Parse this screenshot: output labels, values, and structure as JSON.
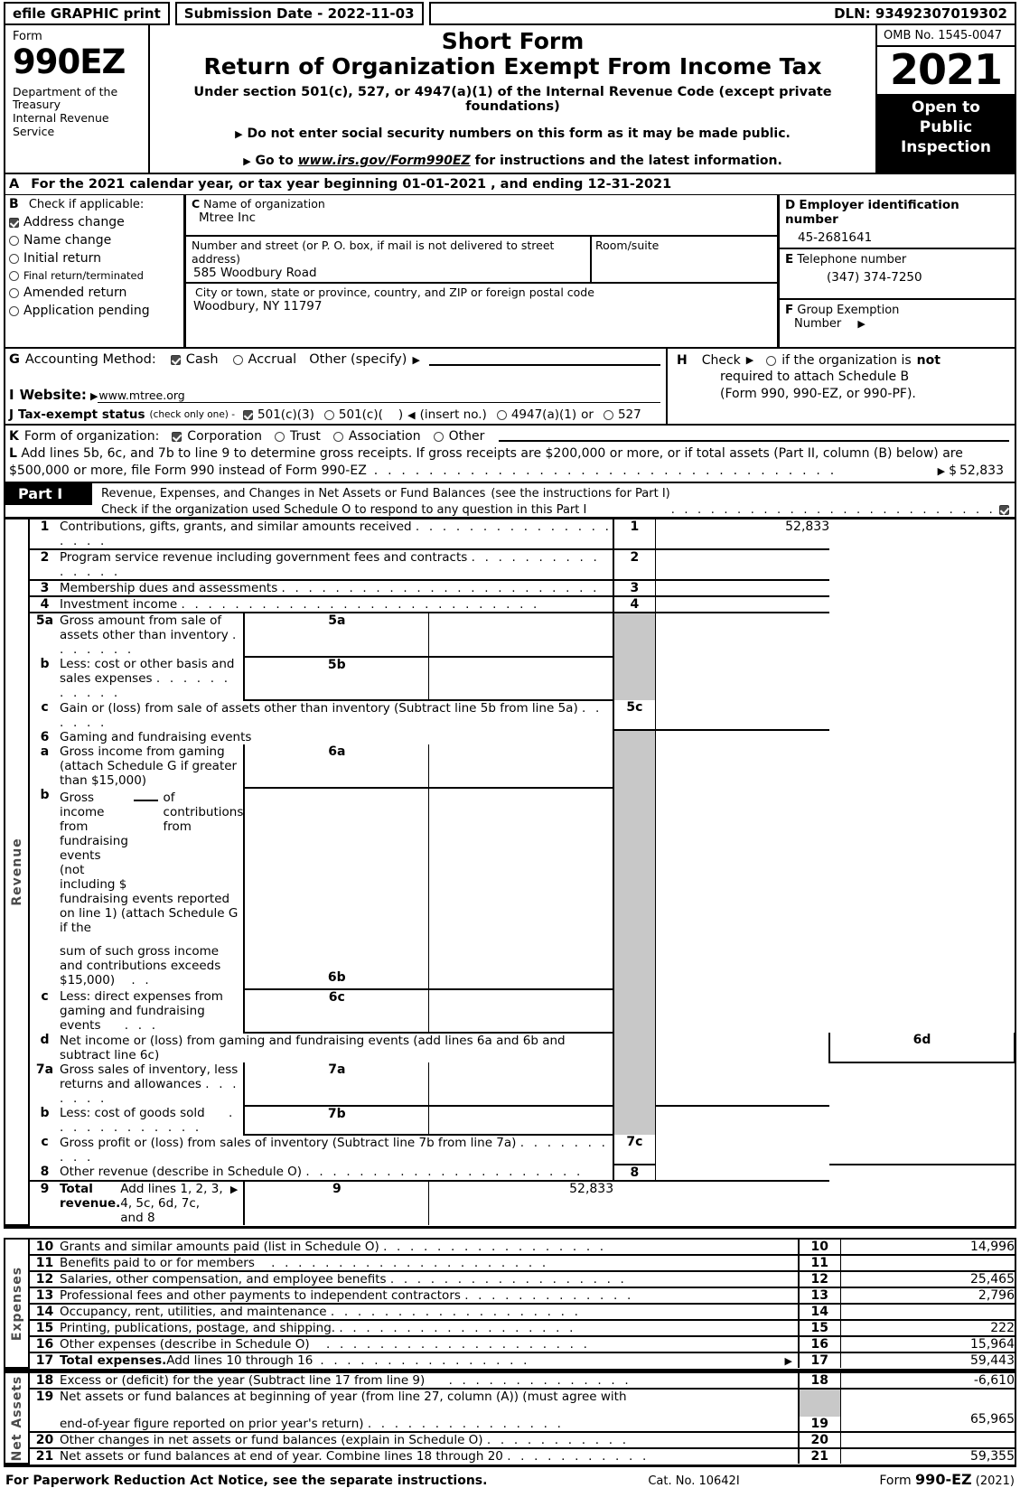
{
  "efile": {
    "graphic_label": "efile GRAPHIC print",
    "submission_label": "Submission Date - 2022-11-03",
    "dln": "DLN: 93492307019302"
  },
  "header": {
    "form_label": "Form",
    "form_number": "990EZ",
    "department": "Department of the Treasury\nInternal Revenue Service",
    "title_short": "Short Form",
    "title_main": "Return of Organization Exempt From Income Tax",
    "subtitle": "Under section 501(c), 527, or 4947(a)(1) of the Internal Revenue Code (except private foundations)",
    "bullet1": "Do not enter social security numbers on this form as it may be made public.",
    "bullet2_pre": "Go to ",
    "bullet2_link": "www.irs.gov/Form990EZ",
    "bullet2_post": " for instructions and the latest information.",
    "omb": "OMB No. 1545-0047",
    "year": "2021",
    "open_to_public": "Open to\nPublic\nInspection"
  },
  "lineA": {
    "letter": "A",
    "text_pre": "For the 2021 calendar year, or tax year beginning ",
    "begin_date": "01-01-2021",
    "text_mid": " , and ending ",
    "end_date": "12-31-2021"
  },
  "sectionB": {
    "letter": "B",
    "title": "Check if applicable:",
    "items": [
      {
        "label": "Address change",
        "checked": true,
        "small": false
      },
      {
        "label": "Name change",
        "checked": false,
        "small": false
      },
      {
        "label": "Initial return",
        "checked": false,
        "small": false
      },
      {
        "label": "Final return/terminated",
        "checked": false,
        "small": true
      },
      {
        "label": "Amended return",
        "checked": false,
        "small": false
      },
      {
        "label": "Application pending",
        "checked": false,
        "small": false
      }
    ]
  },
  "sectionC": {
    "letter": "C",
    "name_caption": "Name of organization",
    "name_value": "Mtree Inc",
    "street_caption": "Number and street (or P. O. box, if mail is not delivered to street address)",
    "street_value": "585 Woodbury Road",
    "room_caption": "Room/suite",
    "room_value": "",
    "city_caption": "City or town, state or province, country, and ZIP or foreign postal code",
    "city_value": "Woodbury, NY   11797"
  },
  "sectionD": {
    "letter": "D",
    "caption": "Employer identification number",
    "value": "45-2681641"
  },
  "sectionE": {
    "letter": "E",
    "caption": "Telephone number",
    "value": "(347) 374-7250"
  },
  "sectionF": {
    "letter": "F",
    "caption_line1": "Group Exemption",
    "caption_line2": "Number",
    "value": ""
  },
  "sectionG": {
    "letter": "G",
    "label": "Accounting Method:",
    "cash": "Cash",
    "cash_checked": true,
    "accrual": "Accrual",
    "accrual_checked": false,
    "other": "Other (specify)",
    "other_value": ""
  },
  "sectionH": {
    "letter": "H",
    "check_label": "Check",
    "text_a": "if the organization is ",
    "text_not": "not",
    "line2": "required to attach Schedule B",
    "line3": "(Form 990, 990-EZ, or 990-PF).",
    "checked": false
  },
  "sectionI": {
    "letter": "I",
    "label": "Website:",
    "value": "www.mtree.org"
  },
  "sectionJ": {
    "letter": "J",
    "label": "Tax-exempt status",
    "note": "(check only one) -",
    "opt1": "501(c)(3)",
    "opt1_checked": true,
    "opt2": "501(c)(",
    "opt2_checked": false,
    "opt2_paren": ")",
    "insert": "(insert no.)",
    "opt3": "4947(a)(1)",
    "opt3_checked": false,
    "or": "or",
    "opt4": "527",
    "opt4_checked": false
  },
  "sectionK": {
    "letter": "K",
    "label": "Form of organization:",
    "options": [
      {
        "label": "Corporation",
        "checked": true
      },
      {
        "label": "Trust",
        "checked": false
      },
      {
        "label": "Association",
        "checked": false
      },
      {
        "label": "Other",
        "checked": false
      }
    ],
    "other_value": ""
  },
  "sectionL": {
    "letter": "L",
    "line1": "Add lines 5b, 6c, and 7b to line 9 to determine gross receipts. If gross receipts are $200,000 or more, or if total assets (Part II, column (B) below) are",
    "line2": "$500,000 or more, file Form 990 instead of Form 990-EZ",
    "amount_prefix": "$",
    "amount": "52,833"
  },
  "partI": {
    "tag": "Part I",
    "title": "Revenue, Expenses, and Changes in Net Assets or Fund Balances",
    "title_note": "(see the instructions for Part I)",
    "schedule_o_text": "Check if the organization used Schedule O to respond to any question in this Part I",
    "schedule_o_checked": true
  },
  "revenue": {
    "vertical_label": "Revenue",
    "rows": [
      {
        "num": "1",
        "desc": "Contributions, gifts, grants, and similar amounts received",
        "dots": 19,
        "code": "1",
        "amount": "52,833",
        "gray": false
      },
      {
        "num": "2",
        "desc": "Program service revenue including government fees and contracts",
        "dots": 15,
        "code": "2",
        "amount": "",
        "gray": false
      },
      {
        "num": "3",
        "desc": "Membership dues and assessments",
        "dots": 24,
        "code": "3",
        "amount": "",
        "gray": false
      },
      {
        "num": "4",
        "desc": "Investment income",
        "dots": 27,
        "code": "4",
        "amount": "",
        "gray": false
      }
    ],
    "line5a": {
      "num": "5a",
      "desc": "Gross amount from sale of assets other than inventory",
      "dots": 7,
      "inner_code": "5a",
      "inner_amount": ""
    },
    "line5b": {
      "num": "b",
      "desc": "Less: cost or other basis and sales expenses",
      "dots": 11,
      "inner_code": "5b",
      "inner_amount": ""
    },
    "line5c": {
      "num": "c",
      "desc": "Gain or (loss) from sale of assets other than inventory (Subtract line 5b from line 5a)",
      "dots": 6,
      "code": "5c",
      "amount": ""
    },
    "line6": {
      "num": "6",
      "desc": "Gaming and fundraising events"
    },
    "line6a": {
      "num": "a",
      "desc": "Gross income from gaming (attach Schedule G if greater than $15,000)",
      "inner_code": "6a",
      "inner_amount": ""
    },
    "line6b": {
      "num": "b",
      "part1_pre": "Gross income from fundraising events (not including $",
      "part1_post": "of contributions from",
      "blank_value": "",
      "part2": "fundraising events reported on line 1) (attach Schedule G if the",
      "part3": "sum of such gross income and contributions exceeds $15,000)",
      "dots": 2,
      "inner_code": "6b",
      "inner_amount": ""
    },
    "line6c": {
      "num": "c",
      "desc": "Less: direct expenses from gaming and fundraising events",
      "dots": 3,
      "inner_code": "6c",
      "inner_amount": ""
    },
    "line6d": {
      "num": "d",
      "desc": "Net income or (loss) from gaming and fundraising events (add lines 6a and 6b and subtract line 6c)",
      "code": "6d",
      "amount": ""
    },
    "line7a": {
      "num": "7a",
      "desc": "Gross sales of inventory, less returns and allowances",
      "dots": 7,
      "inner_code": "7a",
      "inner_amount": ""
    },
    "line7b": {
      "num": "b",
      "desc": "Less: cost of goods sold",
      "dots": 12,
      "inner_code": "7b",
      "inner_amount": ""
    },
    "line7c": {
      "num": "c",
      "desc": "Gross profit or (loss) from sales of inventory (Subtract line 7b from line 7a)",
      "dots": 10,
      "code": "7c",
      "amount": ""
    },
    "line8": {
      "num": "8",
      "desc": "Other revenue (describe in Schedule O)",
      "dots": 21,
      "code": "8",
      "amount": ""
    },
    "line9": {
      "num": "9",
      "desc_bold": "Total revenue.",
      "desc": " Add lines 1, 2, 3, 4, 5c, 6d, 7c, and 8",
      "dots": 17,
      "code": "9",
      "amount": "52,833"
    }
  },
  "expenses": {
    "vertical_label": "Expenses",
    "rows": [
      {
        "num": "10",
        "desc": "Grants and similar amounts paid (list in Schedule O)",
        "dots": 17,
        "code": "10",
        "amount": "14,996"
      },
      {
        "num": "11",
        "desc": "Benefits paid to or for members",
        "dots": 21,
        "code": "11",
        "amount": ""
      },
      {
        "num": "12",
        "desc": "Salaries, other compensation, and employee benefits",
        "dots": 18,
        "code": "12",
        "amount": "25,465"
      },
      {
        "num": "13",
        "desc": "Professional fees and other payments to independent contractors",
        "dots": 13,
        "code": "13",
        "amount": "2,796"
      },
      {
        "num": "14",
        "desc": "Occupancy, rent, utilities, and maintenance",
        "dots": 19,
        "code": "14",
        "amount": ""
      },
      {
        "num": "15",
        "desc": "Printing, publications, postage, and shipping.",
        "dots": 18,
        "code": "15",
        "amount": "222"
      },
      {
        "num": "16",
        "desc": "Other expenses (describe in Schedule O)",
        "dots": 20,
        "code": "16",
        "amount": "15,964"
      }
    ],
    "total": {
      "num": "17",
      "desc_bold": "Total expenses.",
      "desc": " Add lines 10 through 16",
      "dots": 16,
      "code": "17",
      "amount": "59,443"
    }
  },
  "netassets": {
    "vertical_label": "Net Assets",
    "line18": {
      "num": "18",
      "desc": "Excess or (deficit) for the year (Subtract line 17 from line 9)",
      "dots": 14,
      "code": "18",
      "amount": "-6,610"
    },
    "line19": {
      "num": "19",
      "desc1": "Net assets or fund balances at beginning of year (from line 27, column (A)) (must agree with",
      "desc2": "end-of-year figure reported on prior year's return)",
      "dots": 15,
      "code": "19",
      "amount": "65,965"
    },
    "line20": {
      "num": "20",
      "desc": "Other changes in net assets or fund balances (explain in Schedule O)",
      "dots": 11,
      "code": "20",
      "amount": ""
    },
    "line21": {
      "num": "21",
      "desc": "Net assets or fund balances at end of year. Combine lines 18 through 20",
      "dots": 11,
      "code": "21",
      "amount": "59,355"
    }
  },
  "footer": {
    "paperwork": "For Paperwork Reduction Act Notice, see the separate instructions.",
    "cat": "Cat. No. 10642I",
    "form_pre": "Form ",
    "form_no": "990-EZ",
    "form_year": " (2021)"
  },
  "colors": {
    "ink": "#000000",
    "gray_cell": "#c8c8c8",
    "vertical_label": "#4a4a4a"
  }
}
